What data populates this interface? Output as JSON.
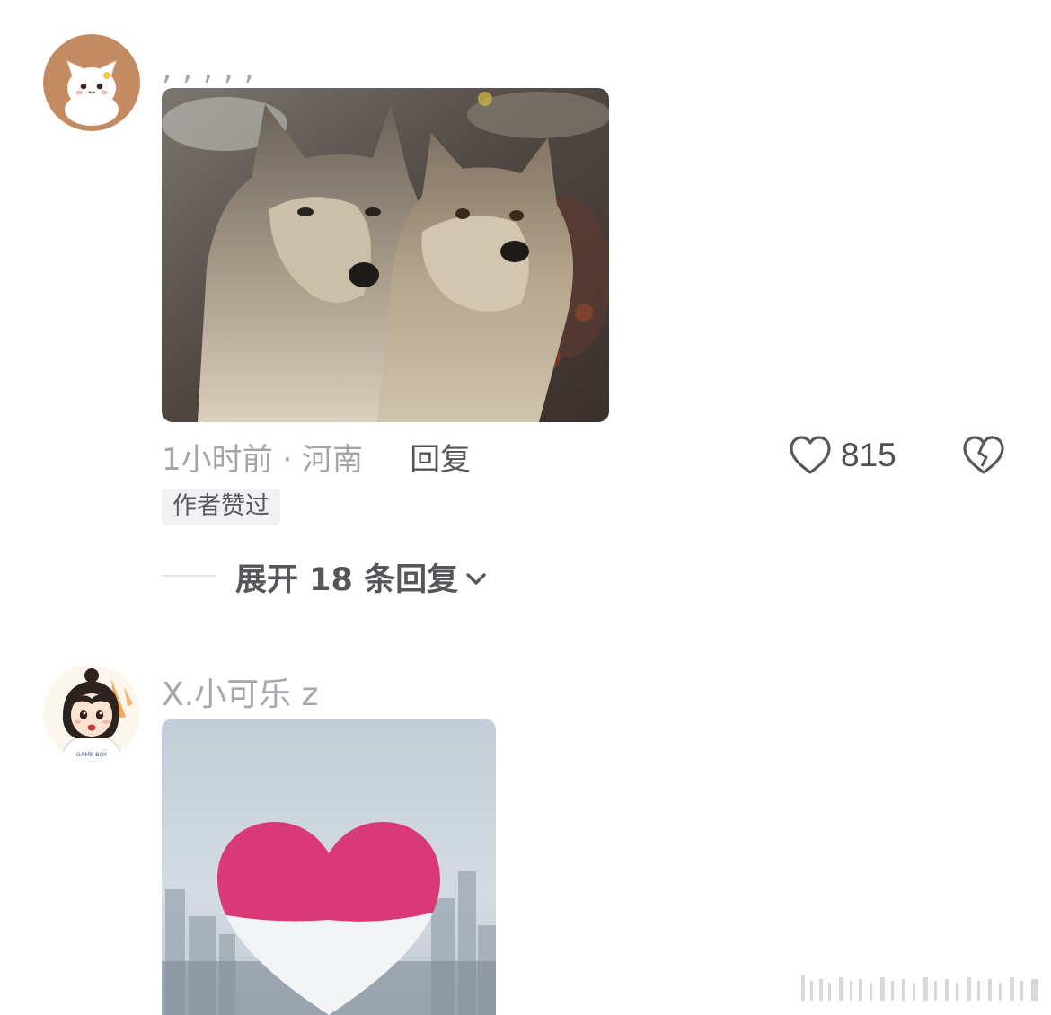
{
  "comments": [
    {
      "username": ", , , , ,",
      "time_location": "1小时前 · 河南",
      "reply_label": "回复",
      "like_count": "815",
      "badge": "作者赞过",
      "expand_label": "展开 18 条回复"
    },
    {
      "username": "X.小可乐 z",
      "avatar_shirt_text": "GAME BOY"
    }
  ],
  "icons": {
    "like": "heart-outline-icon",
    "dislike": "broken-heart-icon",
    "expand": "chevron-down-icon"
  },
  "colors": {
    "muted_text": "#a3a3a8",
    "strong_text": "#555558",
    "badge_bg": "#f1f1f3",
    "heart_pink": "#d93a75"
  }
}
